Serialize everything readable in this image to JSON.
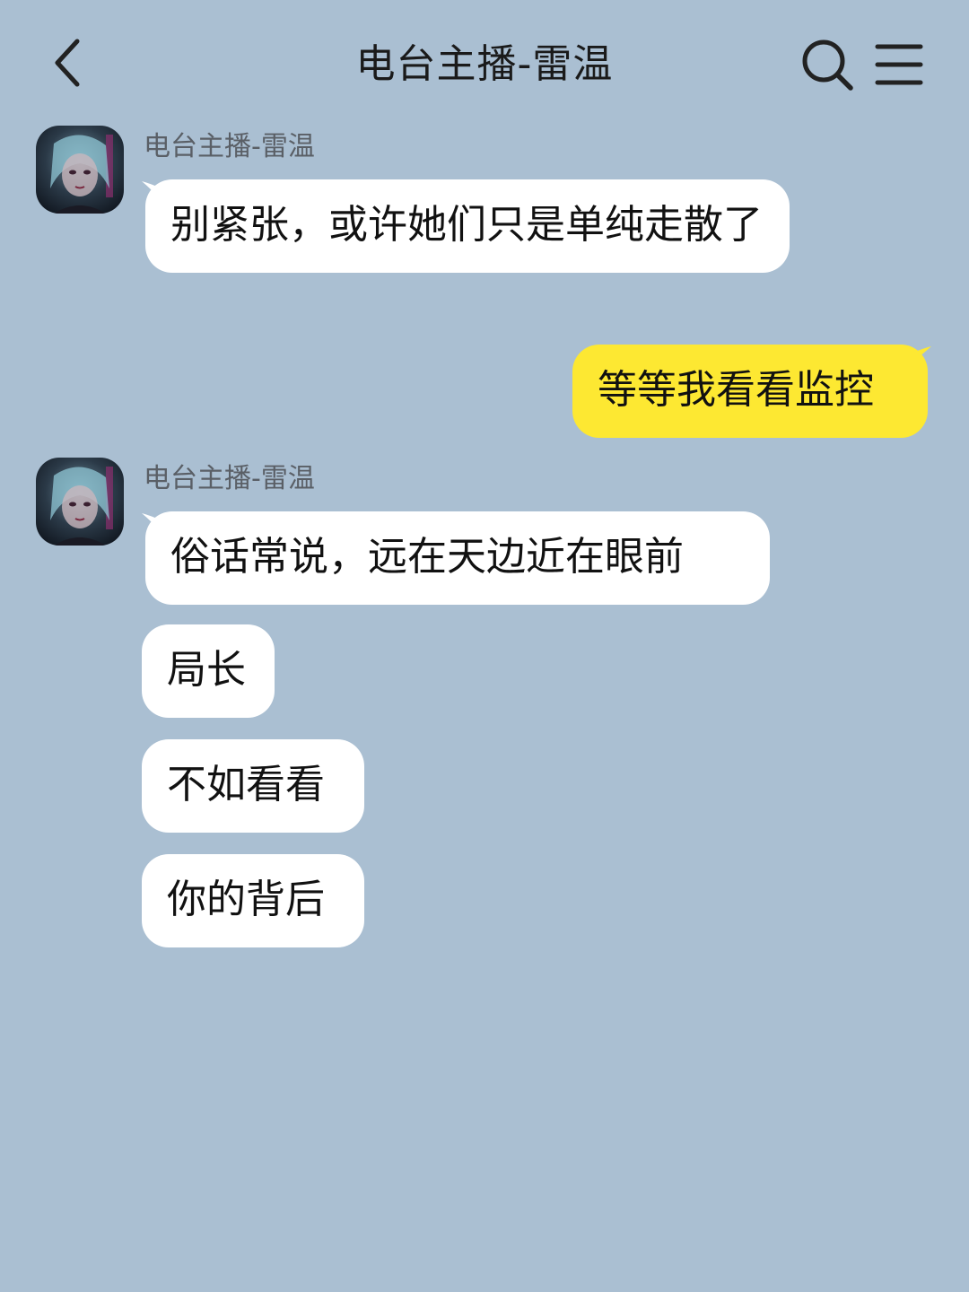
{
  "header": {
    "title": "电台主播-雷温",
    "back_icon": "chevron-left-icon",
    "search_icon": "search-icon",
    "menu_icon": "hamburger-menu-icon"
  },
  "colors": {
    "background": "#aabfd2",
    "incoming_bubble": "#ffffff",
    "outgoing_bubble": "#fde832",
    "text": "#111111",
    "sender_name": "#5a5f66"
  },
  "messages": [
    {
      "sender": "电台主播-雷温",
      "direction": "incoming",
      "bubbles": [
        "别紧张，或许她们只是单纯走散了"
      ]
    },
    {
      "sender": "",
      "direction": "outgoing",
      "bubbles": [
        "等等我看看监控"
      ]
    },
    {
      "sender": "电台主播-雷温",
      "direction": "incoming",
      "bubbles": [
        "俗话常说，远在天边近在眼前",
        "局长",
        "不如看看",
        "你的背后"
      ]
    }
  ]
}
